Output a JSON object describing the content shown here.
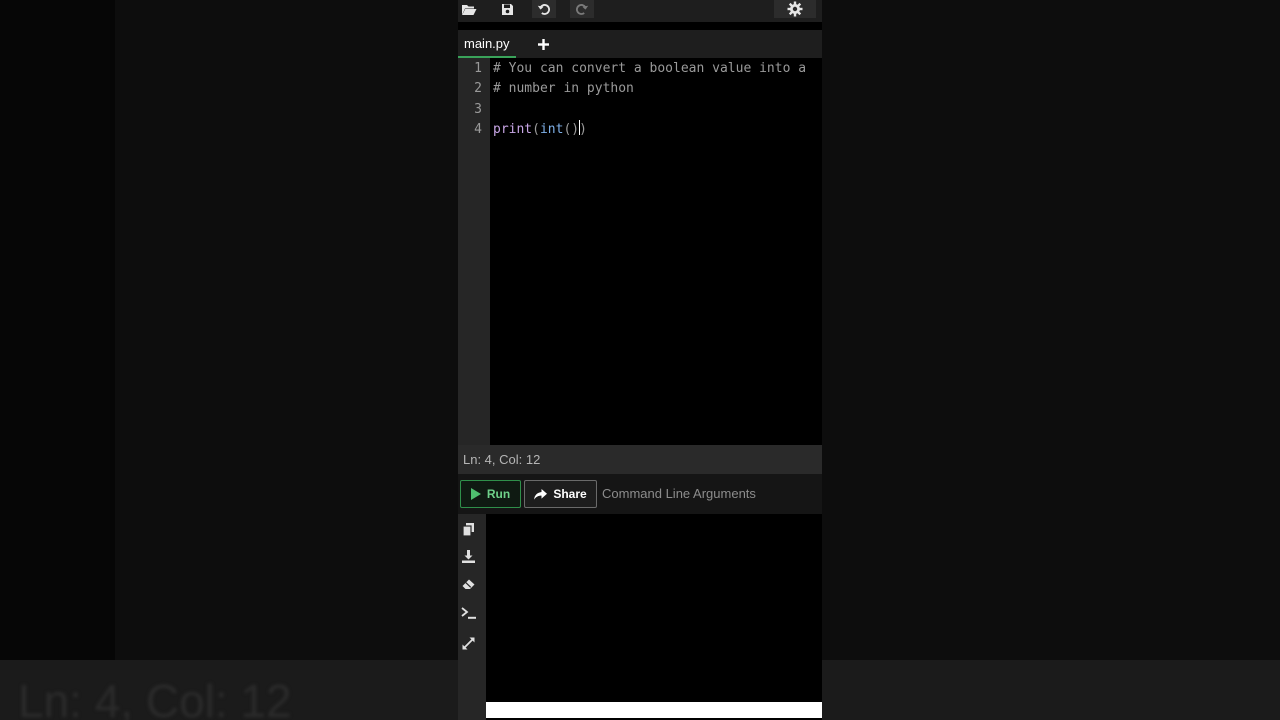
{
  "toolbar": {
    "icons": [
      "open-folder-icon",
      "save-icon",
      "undo-icon",
      "redo-icon",
      "settings-gear-icon"
    ]
  },
  "tabs": {
    "active_label": "main.py",
    "add_label": "+"
  },
  "editor": {
    "lines": [
      {
        "number": "1",
        "text": "# You can convert a boolean value into a"
      },
      {
        "number": "2",
        "text": "# number in python"
      },
      {
        "number": "3",
        "text": ""
      },
      {
        "number": "4",
        "fn": "print",
        "open1": "(",
        "builtin": "int",
        "open2": "(",
        "close2": ")",
        "close1": ")"
      }
    ]
  },
  "status": {
    "position": "Ln: 4,  Col: 12"
  },
  "actions": {
    "run_label": "Run",
    "share_label": "Share",
    "args_placeholder": "Command Line Arguments"
  },
  "console_tools": [
    "copy-icon",
    "download-icon",
    "eraser-icon",
    "terminal-icon",
    "expand-icon"
  ],
  "background": {
    "blurred_status_text": "Ln: 4,  Col: 12"
  },
  "colors": {
    "accent_green": "#3aa35a",
    "run_text": "#6fd18a",
    "keyword_purple": "#c8a6e6",
    "builtin_blue": "#7fb0e8",
    "comment_gray": "#9a9a9a"
  }
}
